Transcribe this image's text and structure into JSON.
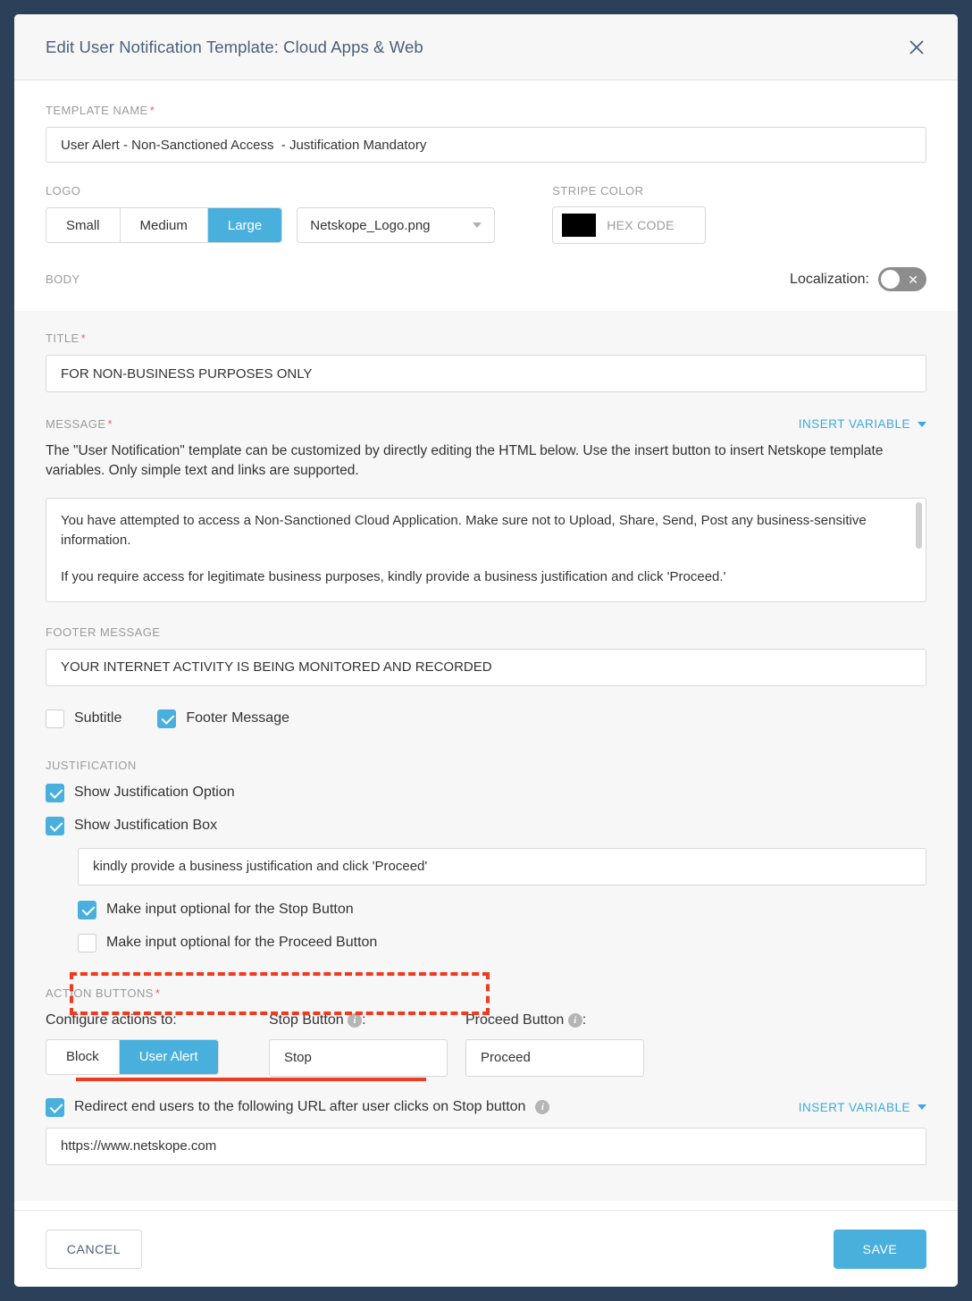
{
  "header": {
    "title": "Edit User Notification Template: Cloud Apps & Web",
    "close_icon": "close-icon"
  },
  "template_name": {
    "label": "TEMPLATE NAME",
    "required": "*",
    "value": "User Alert - Non-Sanctioned Access  - Justification Mandatory"
  },
  "logo": {
    "label": "LOGO",
    "sizes": [
      "Small",
      "Medium",
      "Large"
    ],
    "selected_size": "Large",
    "file": "Netskope_Logo.png",
    "caret_icon": "chevron-down-icon"
  },
  "stripe_color": {
    "label": "STRIPE COLOR",
    "swatch_hex": "#000000",
    "placeholder": "HEX CODE"
  },
  "body_section": {
    "label": "BODY",
    "localization_label": "Localization:",
    "localization_on": false,
    "toggle_off_icon": "x-icon"
  },
  "title_field": {
    "label": "TITLE",
    "required": "*",
    "value": "FOR NON-BUSINESS PURPOSES ONLY"
  },
  "message": {
    "label": "MESSAGE",
    "required": "*",
    "insert_variable_label": "INSERT VARIABLE",
    "help_text": "The \"User Notification\" template can be customized by directly editing the HTML below. Use the insert button to insert Netskope template variables. Only simple text and links are supported.",
    "paragraphs": [
      "You have attempted to access a Non-Sanctioned Cloud Application. Make sure not to Upload, Share, Send, Post any business-sensitive information.",
      "If you require access for legitimate business purposes, kindly provide a business justification and click 'Proceed.'"
    ]
  },
  "footer_message": {
    "label": "FOOTER MESSAGE",
    "value": "YOUR INTERNET ACTIVITY IS BEING MONITORED AND RECORDED"
  },
  "display_options": [
    {
      "label": "Subtitle",
      "checked": false
    },
    {
      "label": "Footer Message",
      "checked": true
    }
  ],
  "justification": {
    "label": "JUSTIFICATION",
    "show_option": {
      "label": "Show Justification Option",
      "checked": true
    },
    "show_box": {
      "label": "Show Justification Box",
      "checked": true
    },
    "box_value": "kindly provide a business justification and click 'Proceed'",
    "stop_optional": {
      "label": "Make input optional for the Stop Button",
      "checked": true
    },
    "proceed_optional": {
      "label": "Make input optional for the Proceed Button",
      "checked": false
    },
    "highlight_color": "#ef3b1f"
  },
  "action_buttons": {
    "label": "ACTION BUTTONS",
    "required": "*",
    "configure_label": "Configure actions to:",
    "modes": [
      "Block",
      "User Alert"
    ],
    "selected_mode": "User Alert",
    "stop_button_label": "Stop Button",
    "stop_button_value": "Stop",
    "proceed_button_label": "Proceed Button",
    "proceed_button_value": "Proceed",
    "info_icon": "info-icon",
    "colon": ":"
  },
  "redirect": {
    "label": "Redirect end users to the following URL after user clicks on Stop button",
    "checked": true,
    "insert_variable_label": "INSERT VARIABLE",
    "url_value": "https://www.netskope.com"
  },
  "footer": {
    "cancel_label": "CANCEL",
    "save_label": "SAVE"
  },
  "colors": {
    "accent": "#49b0dd",
    "page_background": "#2d4059",
    "required_red": "#f4604e",
    "link_blue": "#3aa9e0"
  }
}
